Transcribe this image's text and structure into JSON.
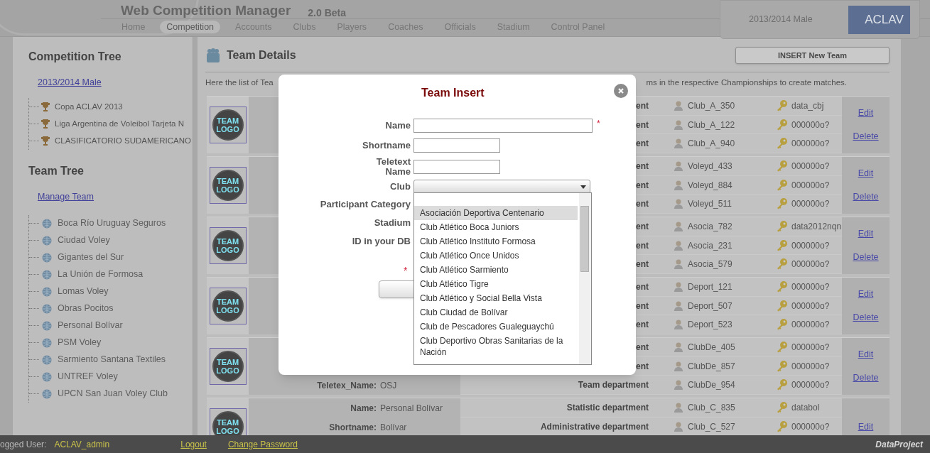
{
  "header": {
    "title": "Web Competition Manager",
    "version": "2.0 Beta",
    "nav": [
      {
        "label": "Home",
        "selected": false
      },
      {
        "label": "Competition",
        "selected": true
      },
      {
        "label": "Accounts",
        "selected": false
      },
      {
        "label": "Clubs",
        "selected": false
      },
      {
        "label": "Players",
        "selected": false
      },
      {
        "label": "Coaches",
        "selected": false
      },
      {
        "label": "Officials",
        "selected": false
      },
      {
        "label": "Stadium",
        "selected": false
      },
      {
        "label": "Control Panel",
        "selected": false
      }
    ],
    "season": "2013/2014 Male",
    "logo_text": "ACLAV"
  },
  "sidebar": {
    "competition_heading": "Competition Tree",
    "season_link": "2013/2014 Male",
    "competitions": [
      "Copa ACLAV 2013",
      "Liga Argentina de Voleibol Tarjeta N",
      "CLASIFICATORIO SUDAMERICANO"
    ],
    "team_heading": "Team Tree",
    "manage_link": "Manage Team",
    "teams": [
      "Boca Río Uruguay Seguros",
      "Ciudad Voley",
      "Gigantes del Sur",
      "La Unión de Formosa",
      "Lomas Voley",
      "Obras Pocitos",
      "Personal Bolívar",
      "PSM Voley",
      "Sarmiento Santana Textiles",
      "UNTREF Voley",
      "UPCN San Juan Voley Club"
    ]
  },
  "main": {
    "title": "Team Details",
    "insert_button": "INSERT New Team",
    "intro_left": "Here the list of Tea",
    "intro_right": "ms in the respective Championships to create matches.",
    "teams": [
      {
        "logo_text": "TEAM LOGO",
        "actions": [
          "Edit",
          "Delete"
        ],
        "lines": [
          {
            "department": "ent",
            "user": "Club_A_350",
            "password": "data_cbj"
          },
          {
            "department": "ent",
            "user": "Club_A_122",
            "password": "000000o?"
          },
          {
            "department": "ent",
            "user": "Club_A_940",
            "password": "000000o?"
          }
        ]
      },
      {
        "logo_text": "TEAM LOGO",
        "actions": [
          "Edit",
          "Delete"
        ],
        "lines": [
          {
            "department": "ent",
            "user": "Voleyd_433",
            "password": "000000o?"
          },
          {
            "department": "ent",
            "user": "Voleyd_884",
            "password": "000000o?"
          },
          {
            "department": "ent",
            "user": "Voleyd_511",
            "password": "000000o?"
          }
        ]
      },
      {
        "logo_text": "TEAM LOGO",
        "actions": [
          "Edit",
          "Delete"
        ],
        "lines": [
          {
            "department": "ent",
            "user": "Asocia_782",
            "password": "data2012nqn"
          },
          {
            "department": "ent",
            "user": "Asocia_231",
            "password": "000000o?"
          },
          {
            "department": "ent",
            "user": "Asocia_579",
            "password": "000000o?"
          }
        ]
      },
      {
        "logo_text": "TEAM LOGO",
        "actions": [
          "Edit",
          "Delete"
        ],
        "lines": [
          {
            "department": "ent",
            "user": "Deport_121",
            "password": "000000o?"
          },
          {
            "department": "ent",
            "user": "Deport_507",
            "password": "000000o?"
          },
          {
            "department": "ent",
            "user": "Deport_523",
            "password": "000000o?"
          }
        ]
      },
      {
        "logo_text": "TEAM LOGO",
        "actions": [
          "Edit",
          "Delete"
        ],
        "lines": [
          {
            "department": "ent",
            "user": "ClubDe_405",
            "password": "000000o?"
          },
          {
            "department": "ent",
            "user": "ClubDe_857",
            "password": "000000o?"
          },
          {
            "label": "Teletex_Name:",
            "value": "OSJ",
            "department": "Team department",
            "user": "ClubDe_954",
            "password": "000000o?"
          }
        ]
      },
      {
        "logo_text": "TEAM LOGO",
        "actions": [
          "Edit"
        ],
        "lines": [
          {
            "label": "Name:",
            "value": "Personal Bolívar",
            "department": "Statistic department",
            "user": "Club_C_835",
            "password": "databol"
          },
          {
            "label": "Shortname:",
            "value": "Bolívar",
            "department": "Administrative department",
            "user": "Club_C_527",
            "password": "000000o?"
          }
        ]
      }
    ]
  },
  "modal": {
    "title": "Team Insert",
    "fields": [
      {
        "kind": "longtext",
        "label": "Name",
        "required": true
      },
      {
        "kind": "shorttext",
        "label": "Shortname",
        "required": false
      },
      {
        "kind": "shorttext",
        "label": "Teletext Name",
        "required": false
      },
      {
        "kind": "select",
        "label": "Club",
        "required": false
      },
      {
        "kind": "hidden",
        "label": "Participant Category",
        "required": false
      },
      {
        "kind": "hidden",
        "label": "Stadium",
        "required": false
      },
      {
        "kind": "hidden",
        "label": "ID in your DB",
        "required": false
      }
    ],
    "required_mark": "*",
    "dropdown": {
      "options": [
        {
          "label": "Asociación Deportiva Centenario",
          "selected": true
        },
        {
          "label": "Club Atlético Boca Juniors",
          "selected": false
        },
        {
          "label": "Club Atlético Instituto Formosa",
          "selected": false
        },
        {
          "label": "Club Atlético Once Unidos",
          "selected": false
        },
        {
          "label": "Club Atlético Sarmiento",
          "selected": false
        },
        {
          "label": "Club Atlético Tigre",
          "selected": false
        },
        {
          "label": "Club Atlético y Social Bella Vista",
          "selected": false
        },
        {
          "label": "Club Ciudad de Bolívar",
          "selected": false
        },
        {
          "label": "Club de Pescadores Gualeguaychú",
          "selected": false
        },
        {
          "label": "Club Deportivo Obras Sanitarias de la Nación",
          "selected": false
        }
      ]
    }
  },
  "status_bar": {
    "user_label": "ogged User:",
    "user": "ACLAV_admin",
    "links": [
      "Logout",
      "Change Password"
    ],
    "brand": "DataProject"
  }
}
